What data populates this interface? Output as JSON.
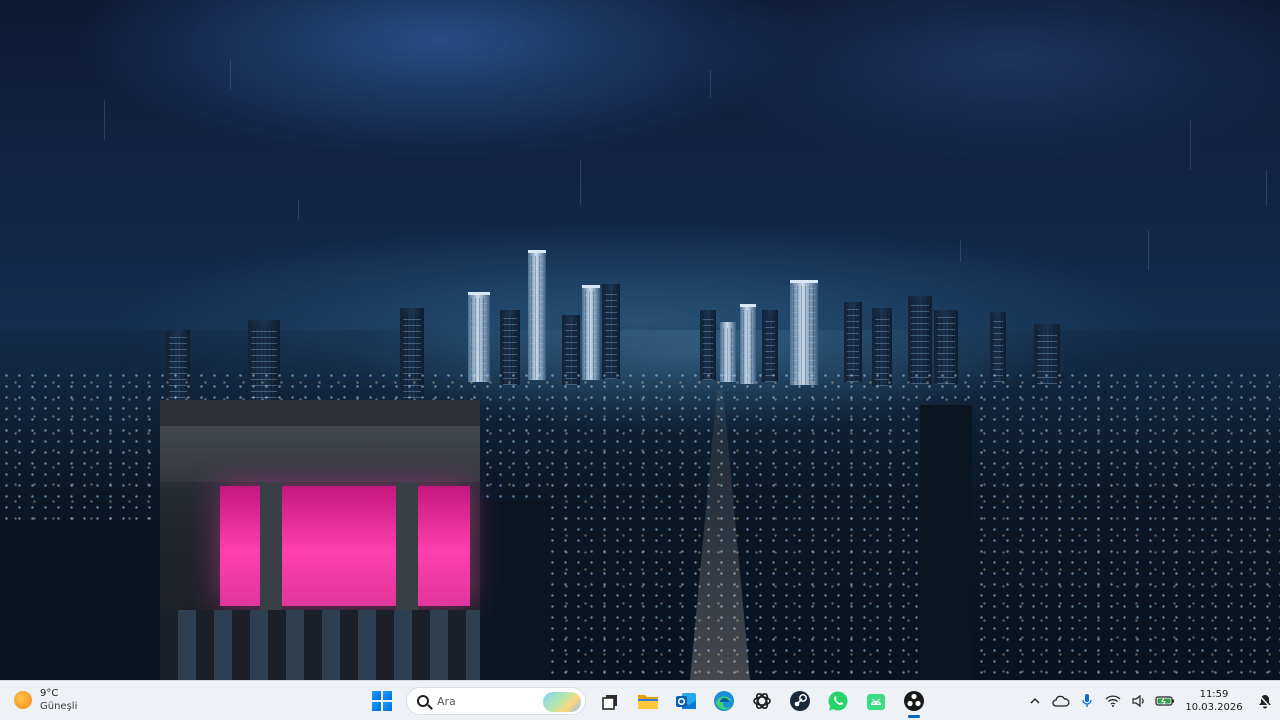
{
  "weather": {
    "temperature": "9°C",
    "condition": "Güneşli",
    "icon": "sun-icon"
  },
  "search": {
    "placeholder": "Ara"
  },
  "taskbar_apps": [
    {
      "name": "start",
      "icon": "windows-logo-icon"
    },
    {
      "name": "task-view",
      "icon": "task-view-icon"
    },
    {
      "name": "file-explorer",
      "icon": "folder-icon"
    },
    {
      "name": "outlook",
      "icon": "outlook-icon"
    },
    {
      "name": "edge",
      "icon": "edge-icon"
    },
    {
      "name": "chatgpt",
      "icon": "chatgpt-icon"
    },
    {
      "name": "steam",
      "icon": "steam-icon"
    },
    {
      "name": "whatsapp",
      "icon": "whatsapp-icon"
    },
    {
      "name": "android-studio",
      "icon": "android-icon"
    },
    {
      "name": "obs",
      "icon": "obs-icon",
      "active": true
    }
  ],
  "tray": {
    "icons": [
      "chevron-up-icon",
      "cloud-icon",
      "microphone-icon",
      "wifi-icon",
      "speaker-icon",
      "battery-icon"
    ],
    "time": "11:59",
    "date": "10.03.2026",
    "notification_icon": "notification-bell-icon"
  },
  "colors": {
    "taskbar_bg": "#eef1f6",
    "accent": "#0067c0",
    "neon_pink": "#ff3fb0"
  }
}
